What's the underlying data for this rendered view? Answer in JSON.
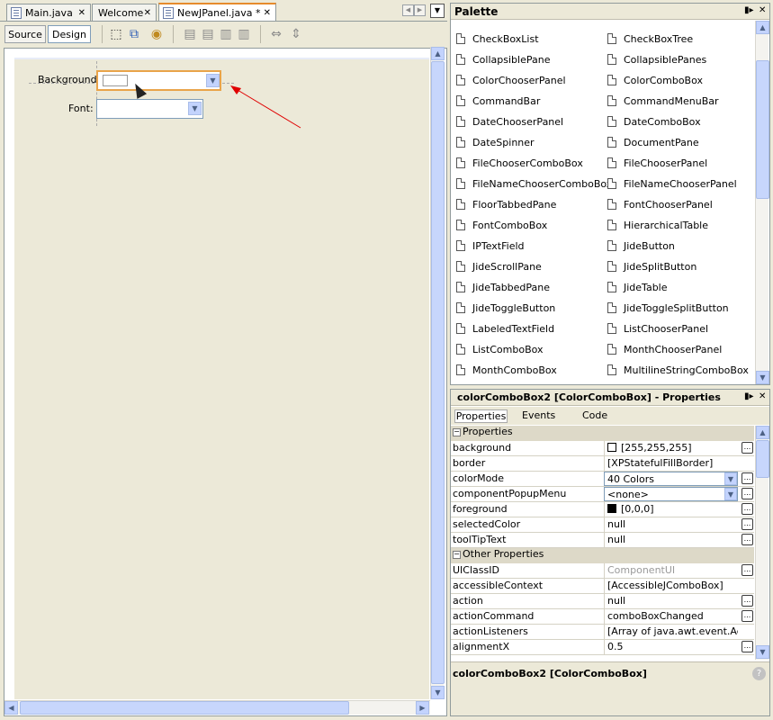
{
  "editor_tabs": [
    {
      "label": "Main.java",
      "icon": "java-file-icon"
    },
    {
      "label": "Welcome",
      "icon": ""
    },
    {
      "label": "NewJPanel.java *",
      "icon": "form-file-icon"
    }
  ],
  "toolbar": {
    "source_label": "Source",
    "design_label": "Design"
  },
  "form": {
    "background_label": "Background:",
    "font_label": "Font:"
  },
  "palette": {
    "title": "Palette",
    "col1": [
      "CheckBoxList",
      "CollapsiblePane",
      "ColorChooserPanel",
      "CommandBar",
      "DateChooserPanel",
      "DateSpinner",
      "FileChooserComboBox",
      "FileNameChooserComboBox",
      "FloorTabbedPane",
      "FontComboBox",
      "IPTextField",
      "JideScrollPane",
      "JideTabbedPane",
      "JideToggleButton",
      "LabeledTextField",
      "ListComboBox",
      "MonthComboBox"
    ],
    "col2": [
      "CheckBoxTree",
      "CollapsiblePanes",
      "ColorComboBox",
      "CommandMenuBar",
      "DateComboBox",
      "DocumentPane",
      "FileChooserPanel",
      "FileNameChooserPanel",
      "FontChooserPanel",
      "HierarchicalTable",
      "JideButton",
      "JideSplitButton",
      "JideTable",
      "JideToggleSplitButton",
      "ListChooserPanel",
      "MonthChooserPanel",
      "MultilineStringComboBox"
    ]
  },
  "properties": {
    "title": "colorComboBox2 [ColorComboBox] - Properties",
    "tabs": [
      "Properties",
      "Events",
      "Code"
    ],
    "cat1": "Properties",
    "rows1": [
      {
        "name": "background",
        "value": "[255,255,255]"
      },
      {
        "name": "border",
        "value": "[XPStatefulFillBorder]"
      },
      {
        "name": "colorMode",
        "value": "40 Colors"
      },
      {
        "name": "componentPopupMenu",
        "value": "<none>"
      },
      {
        "name": "foreground",
        "value": "[0,0,0]"
      },
      {
        "name": "selectedColor",
        "value": "null"
      },
      {
        "name": "toolTipText",
        "value": "null"
      }
    ],
    "cat2": "Other Properties",
    "rows2": [
      {
        "name": "UIClassID",
        "value": "ComponentUI"
      },
      {
        "name": "accessibleContext",
        "value": "[AccessibleJComboBox]"
      },
      {
        "name": "action",
        "value": "null"
      },
      {
        "name": "actionCommand",
        "value": "comboBoxChanged"
      },
      {
        "name": "actionListeners",
        "value": "[Array of java.awt.event.ActionListener]"
      },
      {
        "name": "alignmentX",
        "value": "0.5"
      }
    ],
    "footer": "colorComboBox2 [ColorComboBox]"
  },
  "colors": {
    "accent": "#e68b2c",
    "selection": "#c3d3fd",
    "arrow": "#e00000"
  }
}
